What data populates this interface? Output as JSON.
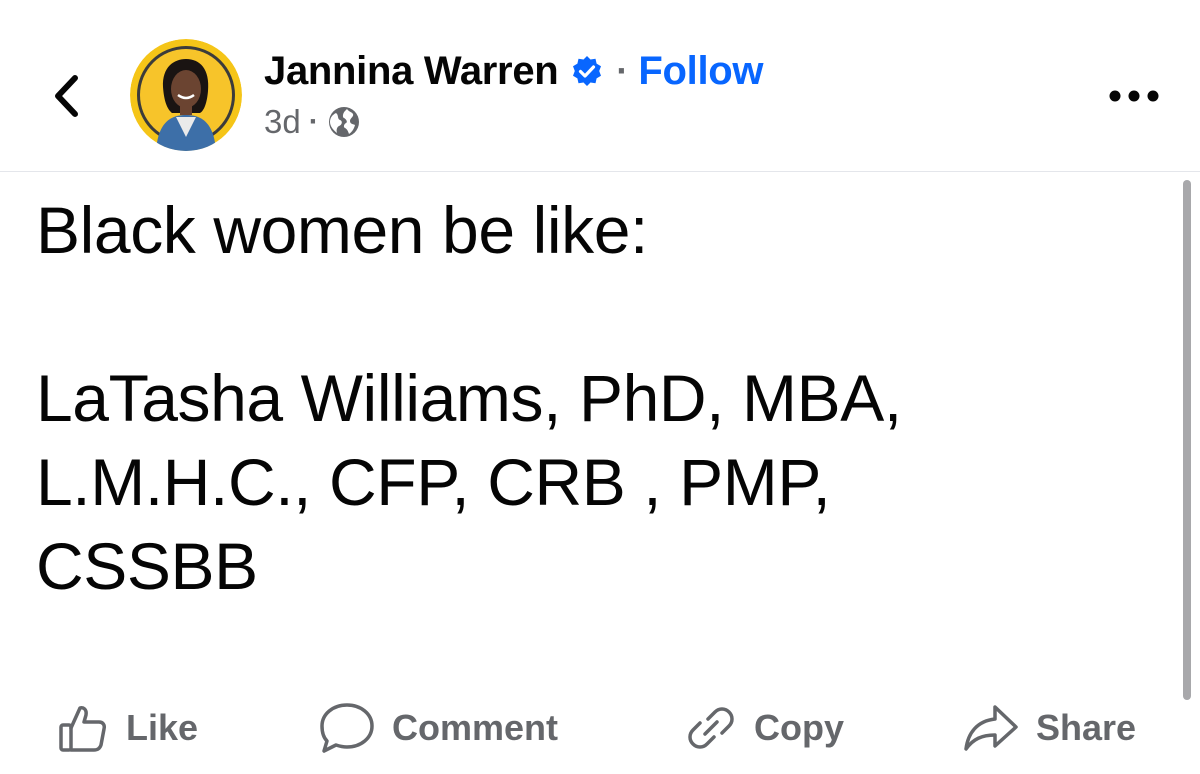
{
  "header": {
    "back_icon": "chevron-left-icon",
    "author_name": "Jannina Warren",
    "verified_icon": "verified-badge-icon",
    "separator": "·",
    "follow_label": "Follow",
    "time": "3d",
    "meta_separator": "·",
    "privacy_icon": "globe-icon",
    "more_icon": "more-horizontal-icon"
  },
  "post": {
    "lines": [
      "Black women be like:",
      "",
      "LaTasha Williams, PhD, MBA,",
      "L.M.H.C., CFP, CRB , PMP,",
      "CSSBB"
    ]
  },
  "actions": {
    "like": {
      "label": "Like",
      "icon": "thumbs-up-icon"
    },
    "comment": {
      "label": "Comment",
      "icon": "comment-bubble-icon"
    },
    "copy": {
      "label": "Copy",
      "icon": "link-icon"
    },
    "share": {
      "label": "Share",
      "icon": "share-arrow-icon"
    }
  },
  "colors": {
    "text": "#050505",
    "secondary": "#65676b",
    "accent": "#0866ff",
    "avatar_ring": "#f5c518"
  }
}
